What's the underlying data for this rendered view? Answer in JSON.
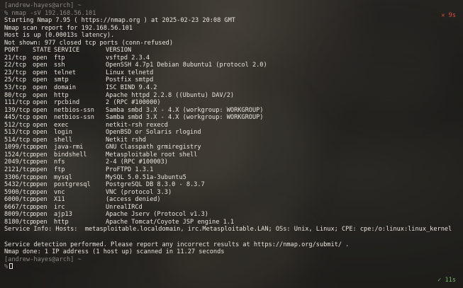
{
  "terminal": {
    "prompt1_user": "[andrew-hayes@arch] ~",
    "prompt1_symbol": "%",
    "command": "nmap -sV 192.168.56.101",
    "status_fail_text": "✕ 9s",
    "header_lines": [
      "Starting Nmap 7.95 ( https://nmap.org ) at 2025-02-23 20:08 GMT",
      "Nmap scan report for 192.168.56.101",
      "Host is up (0.00013s latency).",
      "Not shown: 977 closed tcp ports (conn-refused)"
    ],
    "table_header": {
      "port": "PORT",
      "state": "STATE",
      "service": "SERVICE",
      "version": "VERSION"
    },
    "rows": [
      {
        "port": "21/tcp",
        "state": "open",
        "service": "ftp",
        "version": "vsftpd 2.3.4"
      },
      {
        "port": "22/tcp",
        "state": "open",
        "service": "ssh",
        "version": "OpenSSH 4.7p1 Debian 8ubuntu1 (protocol 2.0)"
      },
      {
        "port": "23/tcp",
        "state": "open",
        "service": "telnet",
        "version": "Linux telnetd"
      },
      {
        "port": "25/tcp",
        "state": "open",
        "service": "smtp",
        "version": "Postfix smtpd"
      },
      {
        "port": "53/tcp",
        "state": "open",
        "service": "domain",
        "version": "ISC BIND 9.4.2"
      },
      {
        "port": "80/tcp",
        "state": "open",
        "service": "http",
        "version": "Apache httpd 2.2.8 ((Ubuntu) DAV/2)"
      },
      {
        "port": "111/tcp",
        "state": "open",
        "service": "rpcbind",
        "version": "2 (RPC #100000)"
      },
      {
        "port": "139/tcp",
        "state": "open",
        "service": "netbios-ssn",
        "version": "Samba smbd 3.X - 4.X (workgroup: WORKGROUP)"
      },
      {
        "port": "445/tcp",
        "state": "open",
        "service": "netbios-ssn",
        "version": "Samba smbd 3.X - 4.X (workgroup: WORKGROUP)"
      },
      {
        "port": "512/tcp",
        "state": "open",
        "service": "exec",
        "version": "netkit-rsh rexecd"
      },
      {
        "port": "513/tcp",
        "state": "open",
        "service": "login",
        "version": "OpenBSD or Solaris rlogind"
      },
      {
        "port": "514/tcp",
        "state": "open",
        "service": "shell",
        "version": "Netkit rshd"
      },
      {
        "port": "1099/tcp",
        "state": "open",
        "service": "java-rmi",
        "version": "GNU Classpath grmiregistry"
      },
      {
        "port": "1524/tcp",
        "state": "open",
        "service": "bindshell",
        "version": "Metasploitable root shell"
      },
      {
        "port": "2049/tcp",
        "state": "open",
        "service": "nfs",
        "version": "2-4 (RPC #100003)"
      },
      {
        "port": "2121/tcp",
        "state": "open",
        "service": "ftp",
        "version": "ProFTPD 1.3.1"
      },
      {
        "port": "3306/tcp",
        "state": "open",
        "service": "mysql",
        "version": "MySQL 5.0.51a-3ubuntu5"
      },
      {
        "port": "5432/tcp",
        "state": "open",
        "service": "postgresql",
        "version": "PostgreSQL DB 8.3.0 - 8.3.7"
      },
      {
        "port": "5900/tcp",
        "state": "open",
        "service": "vnc",
        "version": "VNC (protocol 3.3)"
      },
      {
        "port": "6000/tcp",
        "state": "open",
        "service": "X11",
        "version": "(access denied)"
      },
      {
        "port": "6667/tcp",
        "state": "open",
        "service": "irc",
        "version": "UnrealIRCd"
      },
      {
        "port": "8009/tcp",
        "state": "open",
        "service": "ajp13",
        "version": "Apache Jserv (Protocol v1.3)"
      },
      {
        "port": "8180/tcp",
        "state": "open",
        "service": "http",
        "version": "Apache Tomcat/Coyote JSP engine 1.1"
      }
    ],
    "service_info": "Service Info: Hosts:  metasploitable.localdomain, irc.Metasploitable.LAN; OSs: Unix, Linux; CPE: cpe:/o:linux:linux_kernel",
    "footer_lines": [
      "Service detection performed. Please report any incorrect results at https://nmap.org/submit/ .",
      "Nmap done: 1 IP address (1 host up) scanned in 11.27 seconds"
    ],
    "prompt2_user": "[andrew-hayes@arch] ~",
    "prompt2_symbol": "%",
    "status_ok_text": "✓ 11s"
  }
}
